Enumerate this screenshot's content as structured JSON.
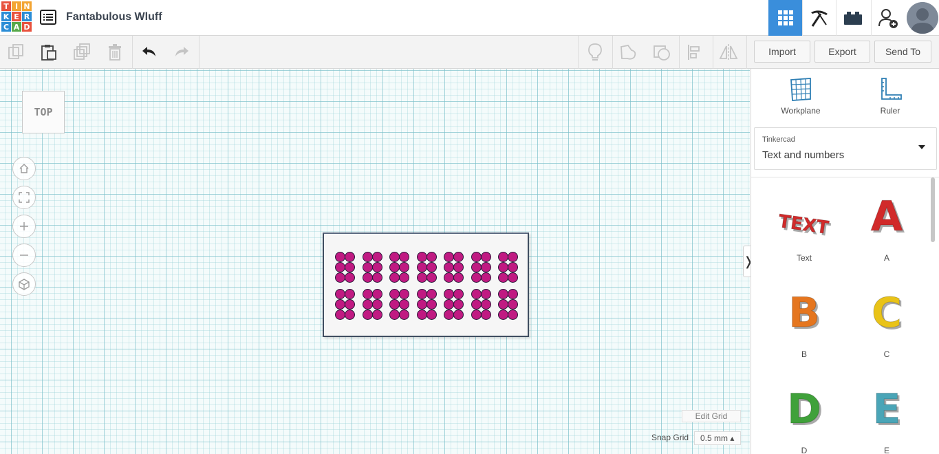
{
  "app": {
    "logo_letters": [
      "T",
      "I",
      "N",
      "K",
      "E",
      "R",
      "C",
      "A",
      "D"
    ],
    "logo_colors": [
      "#e8533f",
      "#f3a533",
      "#f3a533",
      "#2b8dd6",
      "#e8533f",
      "#2b8dd6",
      "#2b8dd6",
      "#58a94b",
      "#e8533f"
    ],
    "menu_icon": "list-icon",
    "title": "Fantabulous Wluff"
  },
  "top_nav": {
    "buttons": [
      {
        "name": "3d-design-button",
        "icon": "grid-icon",
        "active": true
      },
      {
        "name": "codeblocks-button",
        "icon": "pickaxe-icon",
        "active": false
      },
      {
        "name": "bricks-button",
        "icon": "brick-icon",
        "active": false
      },
      {
        "name": "invite-user-button",
        "icon": "user-add-icon",
        "active": false
      }
    ],
    "accent": "#3a8edb"
  },
  "toolbar": {
    "icons": [
      "copy-icon",
      "paste-icon",
      "duplicate-icon",
      "delete-icon",
      "undo-icon",
      "redo-icon",
      "note-icon",
      "comment-icon",
      "show-all-icon",
      "align-icon",
      "mirror-icon"
    ],
    "import_label": "Import",
    "export_label": "Export",
    "sendto_label": "Send To"
  },
  "workplane": {
    "viewcube_label": "TOP",
    "nav_buttons": [
      "home-icon",
      "fit-icon",
      "zoom-in-icon",
      "zoom-out-icon",
      "perspective-icon"
    ],
    "dot_color": "#c01a82",
    "cells_per_row": 7,
    "rows": 2,
    "edit_grid_label": "Edit Grid",
    "snap_grid_label": "Snap Grid",
    "snap_grid_value": "0.5 mm ▴"
  },
  "panel": {
    "workplane_label": "Workplane",
    "ruler_label": "Ruler",
    "library_source": "Tinkercad",
    "library_category": "Text and numbers",
    "shapes": [
      {
        "label": "Text",
        "color": "#d12a2a"
      },
      {
        "label": "A",
        "color": "#d12a2a"
      },
      {
        "label": "B",
        "color": "#e5761f"
      },
      {
        "label": "C",
        "color": "#e9c318"
      },
      {
        "label": "D",
        "color": "#3fa13a"
      },
      {
        "label": "E",
        "color": "#4aa5b7"
      }
    ]
  }
}
